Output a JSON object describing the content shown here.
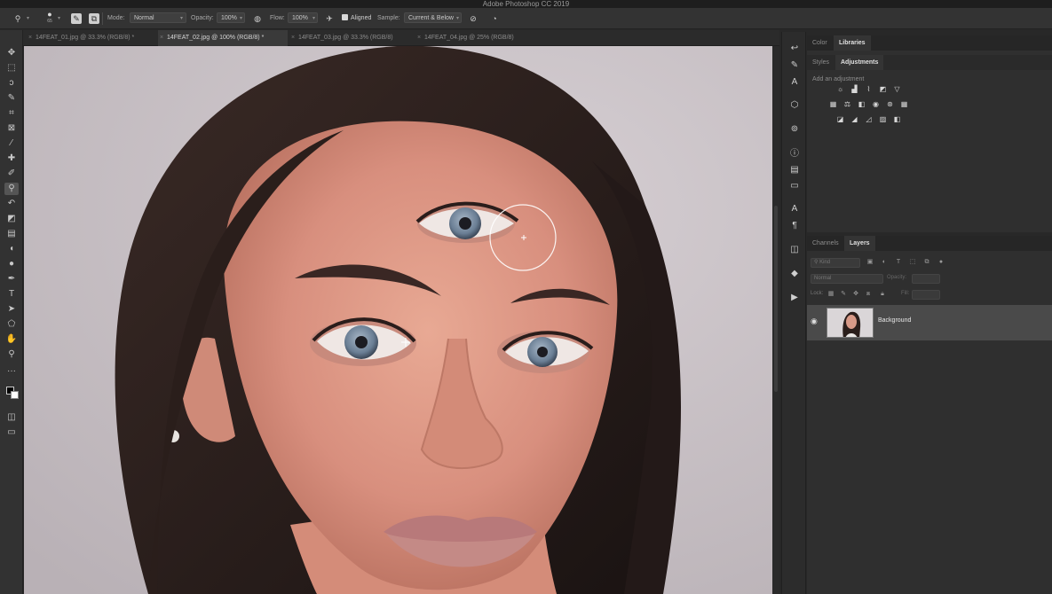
{
  "app": {
    "title": "Adobe Photoshop CC 2019"
  },
  "options_bar": {
    "brush_size": "65",
    "mode_label": "Mode:",
    "mode_value": "Normal",
    "opacity_label": "Opacity:",
    "opacity_value": "100%",
    "flow_label": "Flow:",
    "flow_value": "100%",
    "aligned_label": "Aligned",
    "aligned_checked": true,
    "sample_label": "Sample:",
    "sample_value": "Current & Below"
  },
  "doc_tabs": [
    {
      "label": "14FEAT_01.jpg @ 33.3% (RGB/8) *",
      "active": false
    },
    {
      "label": "14FEAT_02.jpg @ 100% (RGB/8) *",
      "active": true
    },
    {
      "label": "14FEAT_03.jpg @ 33.3% (RGB/8)",
      "active": false
    },
    {
      "label": "14FEAT_04.jpg @ 25% (RGB/8)",
      "active": false
    }
  ],
  "tools": [
    "move-icon",
    "marquee-icon",
    "lasso-icon",
    "quick-select-icon",
    "crop-icon",
    "frame-icon",
    "eyedropper-icon",
    "healing-brush-icon",
    "brush-icon",
    "clone-stamp-icon",
    "history-brush-icon",
    "eraser-icon",
    "gradient-icon",
    "blur-icon",
    "dodge-icon",
    "pen-icon",
    "type-icon",
    "path-select-icon",
    "shape-icon",
    "hand-icon",
    "zoom-icon",
    "more-tools-icon",
    "color-swatches-icon",
    "quick-mask-icon",
    "screen-mode-icon"
  ],
  "top_panel": {
    "tabs": [
      {
        "label": "Color"
      },
      {
        "label": "Libraries"
      }
    ],
    "subtabs": [
      {
        "label": "Styles"
      },
      {
        "label": "Adjustments"
      }
    ],
    "hint": "Add an adjustment"
  },
  "layers_panel": {
    "tabs": [
      {
        "label": "Channels"
      },
      {
        "label": "Layers"
      }
    ],
    "kind_placeholder": "Kind",
    "blend_mode": "Normal",
    "opacity_label": "Opacity:",
    "lock_label": "Lock:",
    "fill_label": "Fill:",
    "layer_name": "Background"
  },
  "colors": {
    "accent": "#4a4a4a",
    "panel": "#2f2f2f",
    "ui_dark": "#282828"
  }
}
